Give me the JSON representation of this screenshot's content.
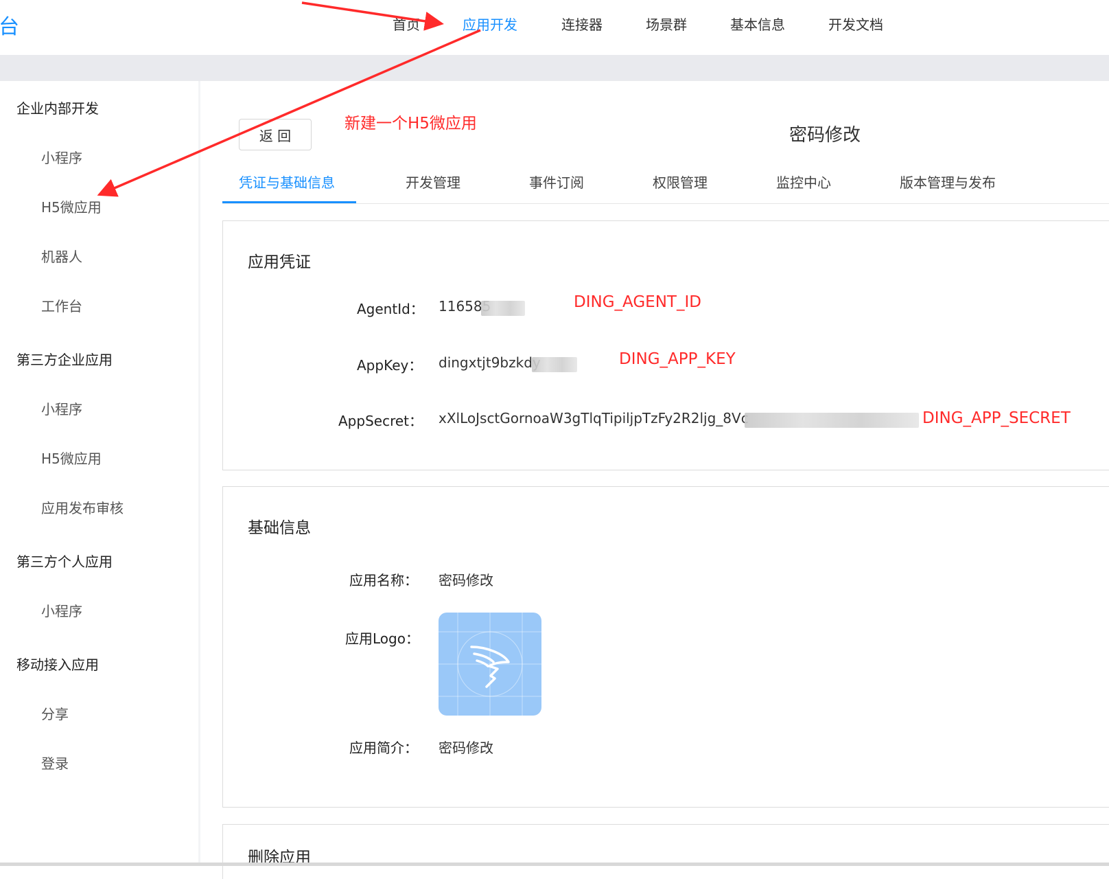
{
  "header": {
    "logo_fragment": "台",
    "nav": [
      {
        "label": "首页",
        "active": false
      },
      {
        "label": "应用开发",
        "active": true
      },
      {
        "label": "连接器",
        "active": false
      },
      {
        "label": "场景群",
        "active": false
      },
      {
        "label": "基本信息",
        "active": false
      },
      {
        "label": "开发文档",
        "active": false
      }
    ]
  },
  "sidebar": {
    "groups": [
      {
        "title": "企业内部开发",
        "items": [
          "小程序",
          "H5微应用",
          "机器人",
          "工作台"
        ]
      },
      {
        "title": "第三方企业应用",
        "items": [
          "小程序",
          "H5微应用",
          "应用发布审核"
        ]
      },
      {
        "title": "第三方个人应用",
        "items": [
          "小程序"
        ]
      },
      {
        "title": "移动接入应用",
        "items": [
          "分享",
          "登录"
        ]
      }
    ]
  },
  "main": {
    "back_label": "返 回",
    "page_title": "密码修改",
    "tabs": [
      "凭证与基础信息",
      "开发管理",
      "事件订阅",
      "权限管理",
      "监控中心",
      "版本管理与发布"
    ],
    "active_tab": "凭证与基础信息",
    "credentials": {
      "title": "应用凭证",
      "agent_id_label": "AgentId：",
      "agent_id_value": "116585",
      "app_key_label": "AppKey：",
      "app_key_value": "dingxtjt9bzkdy",
      "app_secret_label": "AppSecret：",
      "app_secret_value": "xXlLoJsctGornoaW3gTlqTipiljpTzFy2R2ljg_8Vc"
    },
    "basic_info": {
      "title": "基础信息",
      "name_label": "应用名称：",
      "name_value": "密码修改",
      "logo_label": "应用Logo：",
      "logo_icon": "dingtalk-wing-icon",
      "desc_label": "应用简介：",
      "desc_value": "密码修改"
    },
    "delete_section": {
      "title": "删除应用"
    }
  },
  "annotations": {
    "create_h5": "新建一个H5微应用",
    "agent_id": "DING_AGENT_ID",
    "app_key": "DING_APP_KEY",
    "app_secret": "DING_APP_SECRET",
    "color": "#ff2a2a"
  },
  "colors": {
    "accent": "#1890ff",
    "logo_bg": "#9ac8f8",
    "band": "#e9eaee"
  }
}
